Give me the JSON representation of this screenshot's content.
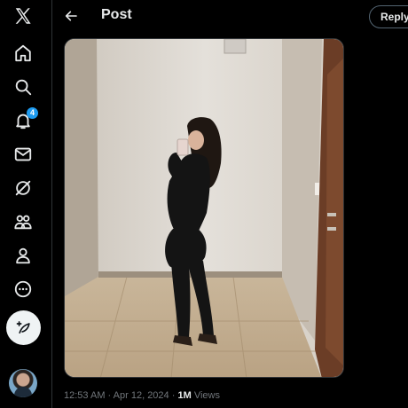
{
  "header": {
    "title": "Post",
    "reply_label": "Reply"
  },
  "nav": {
    "items": [
      {
        "icon": "x-logo-icon"
      },
      {
        "icon": "home-icon"
      },
      {
        "icon": "search-icon"
      },
      {
        "icon": "notifications-icon",
        "badge": "4"
      },
      {
        "icon": "messages-icon"
      },
      {
        "icon": "grok-icon"
      },
      {
        "icon": "communities-icon"
      },
      {
        "icon": "profile-icon"
      },
      {
        "icon": "more-icon"
      }
    ],
    "compose_icon": "compose-icon",
    "accent_color": "#1d9bf0"
  },
  "tweet": {
    "time": "12:53 AM",
    "separator": "·",
    "date": "Apr 12, 2024",
    "views_count": "1M",
    "views_label": "Views"
  }
}
